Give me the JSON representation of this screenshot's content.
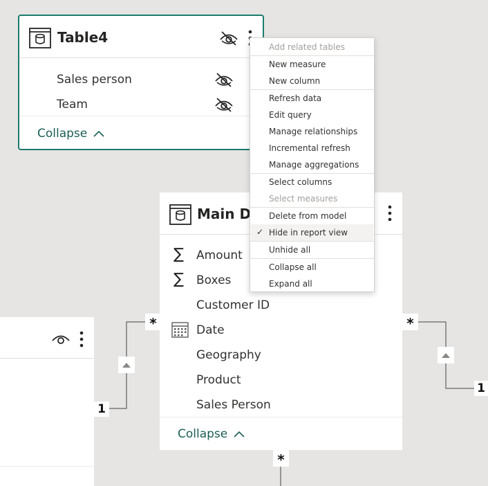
{
  "table4": {
    "title": "Table4",
    "fields": [
      {
        "label": "Sales person",
        "icon": "eye-off-icon"
      },
      {
        "label": "Team",
        "icon": "eye-off-icon"
      }
    ],
    "collapse_label": "Collapse"
  },
  "main_data": {
    "title": "Main Da",
    "fields": [
      {
        "label": "Amount",
        "icon": "sigma-icon"
      },
      {
        "label": "Boxes",
        "icon": "sigma-icon"
      },
      {
        "label": "Customer ID",
        "icon": ""
      },
      {
        "label": "Date",
        "icon": "calendar-icon"
      },
      {
        "label": "Geography",
        "icon": ""
      },
      {
        "label": "Product",
        "icon": ""
      },
      {
        "label": "Sales Person",
        "icon": ""
      }
    ],
    "collapse_label": "Collapse"
  },
  "context_menu": {
    "items": [
      {
        "label": "Add related tables",
        "disabled": true
      },
      {
        "label": "New measure",
        "disabled": false
      },
      {
        "label": "New column",
        "disabled": false
      },
      {
        "label": "Refresh data",
        "disabled": false
      },
      {
        "label": "Edit query",
        "disabled": false
      },
      {
        "label": "Manage relationships",
        "disabled": false
      },
      {
        "label": "Incremental refresh",
        "disabled": false
      },
      {
        "label": "Manage aggregations",
        "disabled": false
      },
      {
        "label": "Select columns",
        "disabled": false
      },
      {
        "label": "Select measures",
        "disabled": true
      },
      {
        "label": "Delete from model",
        "disabled": false
      },
      {
        "label": "Hide in report view",
        "disabled": false,
        "checked": true
      },
      {
        "label": "Unhide all",
        "disabled": false
      },
      {
        "label": "Collapse all",
        "disabled": false
      },
      {
        "label": "Expand all",
        "disabled": false
      }
    ],
    "check_glyph": "✓"
  },
  "relationships": {
    "many_symbol": "*",
    "one_label": "1"
  },
  "colors": {
    "canvas": "#e6e5e3",
    "selected_border": "#1b7b6c",
    "collapse_text": "#1b5e54",
    "disabled_text": "#a19f9d"
  }
}
